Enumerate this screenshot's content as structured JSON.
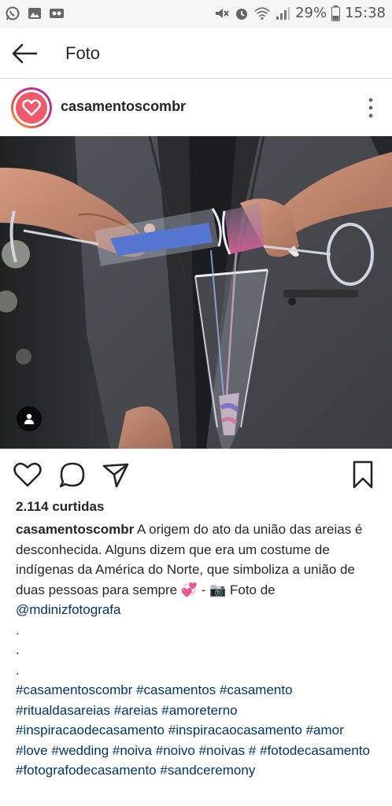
{
  "status_bar": {
    "battery": "29%",
    "time": "15:38"
  },
  "app_bar": {
    "title": "Foto"
  },
  "post": {
    "username": "casamentoscombr",
    "likes": "2.114 curtidas",
    "caption": {
      "username": "casamentoscombr",
      "text": "A origem do ato da união das areias é desconhecida. Alguns dizem que era um costume de indígenas da América do Norte, que simboliza a união de duas pessoas para sempre",
      "emoji": "💞",
      "dash": " -",
      "camera_emoji": "📷",
      "photo_credit": " Foto de ",
      "mention": "@mdinizfotografa",
      "dots": [
        ".",
        ".",
        "."
      ],
      "hashtags": [
        "#casamentoscombr",
        "#casamentos",
        "#casamento",
        "#ritualdasareias",
        "#areias",
        "#amoreterno",
        "#inspiracaodecasamento",
        "#inspiracaocasamento",
        "#amor",
        "#love",
        "#wedding",
        "#noiva",
        "#noivo",
        "#noivas",
        "#",
        "#fotodecasamento",
        "#fotografodecasamento",
        "#sandceremony"
      ]
    }
  },
  "colors": {
    "link": "#003569",
    "text": "#262626",
    "divider": "#dbdbdb"
  }
}
